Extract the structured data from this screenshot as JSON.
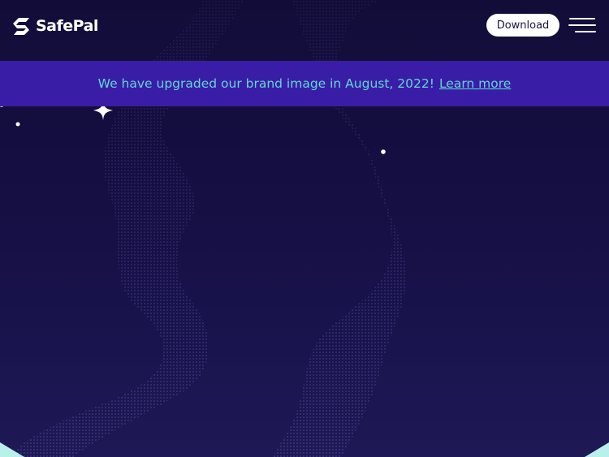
{
  "header": {
    "brand_name": "SafePal",
    "download_label": "Download"
  },
  "banner": {
    "message": "We have upgraded our brand image in August, 2022!",
    "link_label": "Learn more"
  },
  "icons": {
    "logo": "safepal-logo-icon",
    "menu": "hamburger-menu-icon",
    "sparkle": "sparkle-icon"
  },
  "colors": {
    "background": "#120e3a",
    "banner": "#3a1da6",
    "accent_text": "#5fd9d2",
    "button_bg": "#ffffff"
  }
}
